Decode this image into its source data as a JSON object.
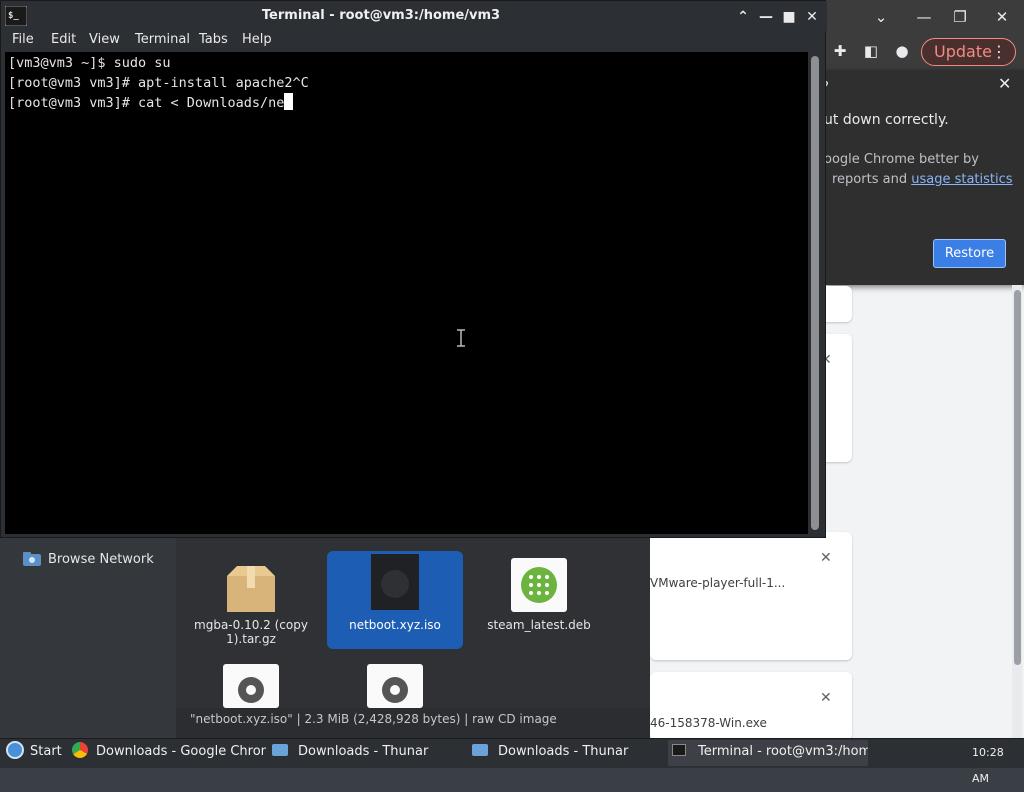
{
  "terminal": {
    "title": "Terminal - root@vm3:/home/vm3",
    "menu": [
      "File",
      "Edit",
      "View",
      "Terminal",
      "Tabs",
      "Help"
    ],
    "lines": [
      "[vm3@vm3 ~]$ sudo su",
      "[root@vm3 vm3]# apt-install apache2^C",
      "[root@vm3 vm3]# cat < Downloads/ne"
    ]
  },
  "chrome": {
    "update_label": "Update",
    "restore_popup": {
      "partial_title": "?",
      "message": "ut down correctly.",
      "sub1": "oogle Chrome better by",
      "sub2": "reports and",
      "link": "usage statistics",
      "restore_label": "Restore"
    },
    "downloads": [
      {
        "name": "VMware-player-full-1..."
      },
      {
        "name": "46-158378-Win.exe"
      }
    ]
  },
  "thunar": {
    "sidebar_item": "Browse Network",
    "files": [
      {
        "label": "mgba-0.10.2 (copy 1).tar.gz",
        "type": "archive"
      },
      {
        "label": "netboot.xyz.iso",
        "type": "iso",
        "selected": true
      },
      {
        "label": "steam_latest.deb",
        "type": "deb"
      }
    ],
    "status": "\"netboot.xyz.iso\"  |  2.3 MiB (2,428,928 bytes)  |  raw CD image"
  },
  "taskbar": {
    "start_label": "Start",
    "tasks": [
      {
        "label": "Downloads - Google Chrome",
        "icon": "chrome-icon"
      },
      {
        "label": "Downloads - Thunar",
        "icon": "folder-icon"
      },
      {
        "label": "Downloads - Thunar",
        "icon": "folder-icon"
      },
      {
        "label": "Terminal - root@vm3:/hom...",
        "icon": "terminal-icon"
      }
    ],
    "clock": "10:28 AM"
  }
}
